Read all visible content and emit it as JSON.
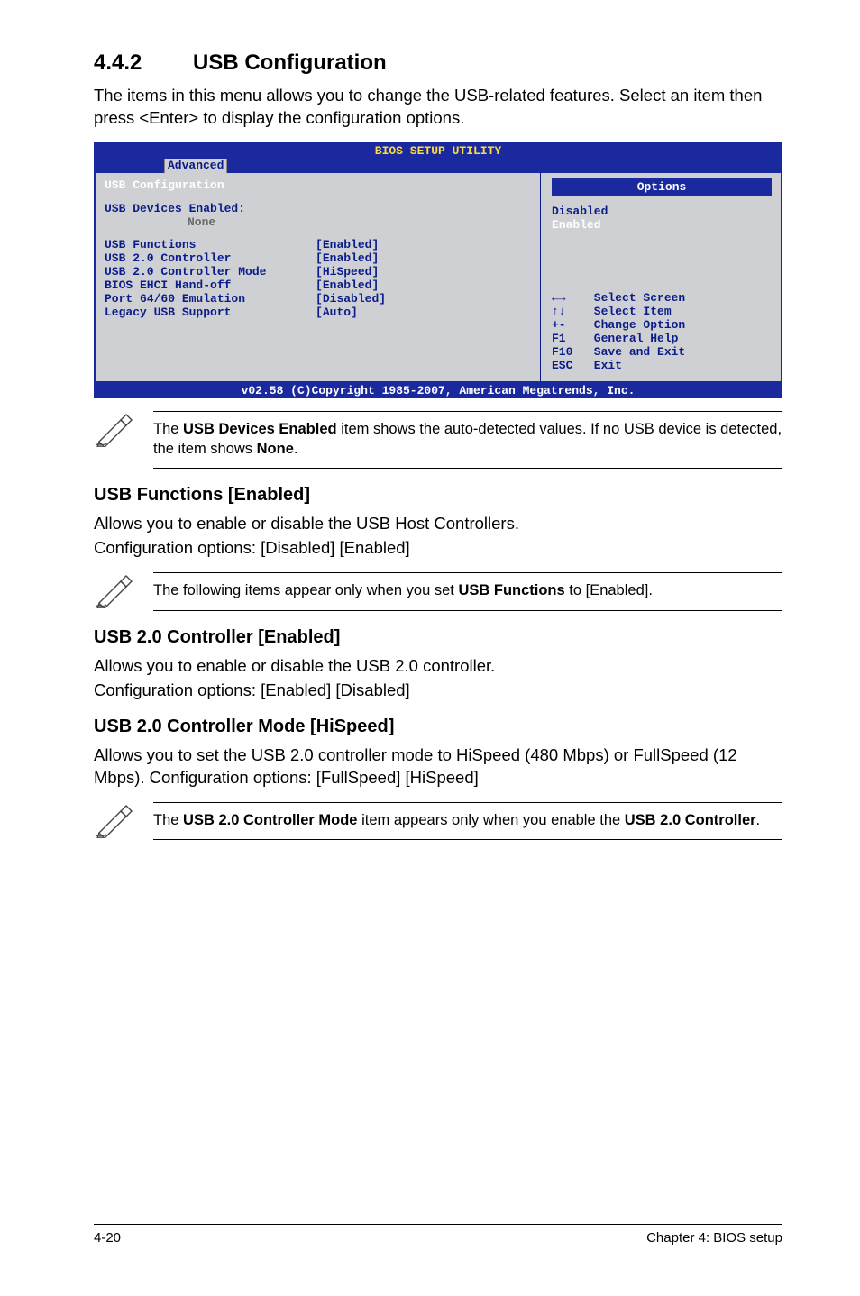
{
  "section": {
    "number": "4.4.2",
    "title": "USB Configuration"
  },
  "intro": "The items in this menu allows you to change the USB-related features. Select an item then press <Enter> to display the configuration options.",
  "bios": {
    "headerTitle": "BIOS SETUP UTILITY",
    "tab": "Advanced",
    "left": {
      "title": "USB Configuration",
      "devicesLabel": "USB Devices Enabled:",
      "devicesValue": "None",
      "rows": [
        {
          "label": "USB Functions",
          "value": "[Enabled]"
        },
        {
          "label": "USB 2.0 Controller",
          "value": "[Enabled]"
        },
        {
          "label": "USB 2.0 Controller Mode",
          "value": "[HiSpeed]"
        },
        {
          "label": "BIOS EHCI Hand-off",
          "value": "[Enabled]"
        },
        {
          "label": "Port 64/60 Emulation",
          "value": "[Disabled]"
        },
        {
          "label": "Legacy USB Support",
          "value": "[Auto]"
        }
      ]
    },
    "right": {
      "optionsTitle": "Options",
      "options": [
        "Disabled",
        "Enabled"
      ],
      "help": [
        {
          "k": "←→",
          "v": "Select Screen"
        },
        {
          "k": "↑↓",
          "v": "Select Item"
        },
        {
          "k": "+-",
          "v": "Change Option"
        },
        {
          "k": "F1",
          "v": "General Help"
        },
        {
          "k": "F10",
          "v": "Save and Exit"
        },
        {
          "k": "ESC",
          "v": "Exit"
        }
      ]
    },
    "footer": "v02.58 (C)Copyright 1985-2007, American Megatrends, Inc."
  },
  "note1": {
    "pre": "The ",
    "b1": "USB Devices Enabled",
    "mid": " item shows the auto-detected values. If no USB device is detected, the item shows ",
    "b2": "None",
    "post": "."
  },
  "usbFunctions": {
    "title": "USB Functions [Enabled]",
    "p1": "Allows you to enable or disable the USB Host Controllers.",
    "p2": "Configuration options: [Disabled] [Enabled]"
  },
  "note2": {
    "pre": "The following items appear only when you set ",
    "b": "USB Functions",
    "post": " to [Enabled]."
  },
  "usb20ctrl": {
    "title": "USB 2.0 Controller [Enabled]",
    "p1": "Allows you to enable or disable the USB 2.0 controller.",
    "p2": "Configuration options: [Enabled] [Disabled]"
  },
  "usb20mode": {
    "title": "USB 2.0 Controller Mode [HiSpeed]",
    "p": "Allows you to set the USB 2.0 controller mode to HiSpeed (480 Mbps) or FullSpeed (12 Mbps). Configuration options: [FullSpeed] [HiSpeed]"
  },
  "note3": {
    "pre": "The ",
    "b1": "USB 2.0 Controller Mode",
    "mid": " item appears only when you enable the ",
    "b2": "USB 2.0 Controller",
    "post": "."
  },
  "footer": {
    "left": "4-20",
    "right": "Chapter 4: BIOS setup"
  }
}
